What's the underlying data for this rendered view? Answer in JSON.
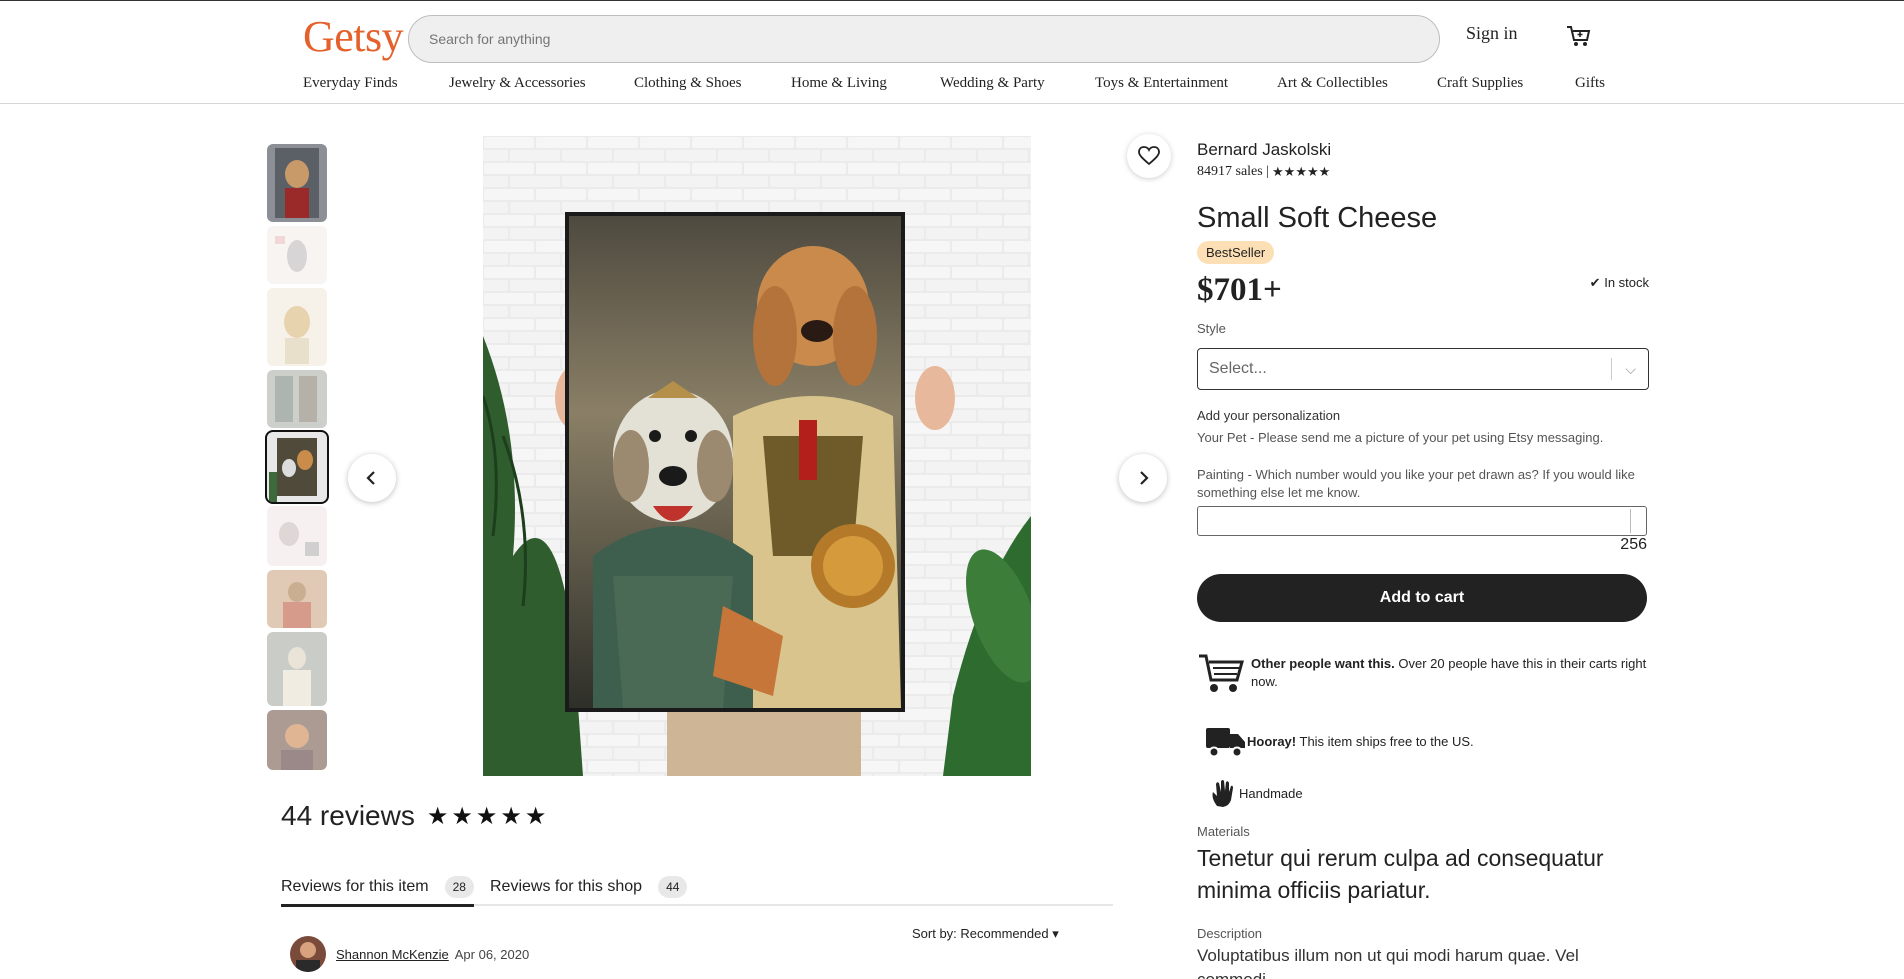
{
  "header": {
    "logo": "Getsy",
    "search_placeholder": "Search for anything",
    "sign_in": "Sign in"
  },
  "nav": {
    "items": [
      "Everyday Finds",
      "Jewelry & Accessories",
      "Clothing & Shoes",
      "Home & Living",
      "Wedding & Party",
      "Toys & Entertainment",
      "Art & Collectibles",
      "Craft Supplies",
      "Gifts"
    ]
  },
  "product": {
    "shop_name": "Bernard Jaskolski",
    "sales": "84917 sales |",
    "rating_stars": "★★★★★",
    "title": "Small Soft Cheese",
    "badge": "BestSeller",
    "price": "$701+",
    "stock": "In stock",
    "style_label": "Style",
    "style_placeholder": "Select...",
    "personalization_title": "Add your personalization",
    "personalization_desc": "Your Pet - Please send me a picture of your pet using Etsy messaging.",
    "painting_prompt": "Painting - Which number would you like your pet drawn as? If you would like something else let me know.",
    "char_count": "256",
    "add_to_cart": "Add to cart",
    "demand_bold": "Other people want this.",
    "demand_text": " Over 20 people have this in their carts right now.",
    "shipping_bold": "Hooray!",
    "shipping_text": " This item ships free to the US.",
    "handmade": "Handmade",
    "materials_label": "Materials",
    "materials": "Tenetur qui rerum culpa ad consequatur minima officiis pariatur.",
    "description_label": "Description",
    "description": "Voluptatibus illum non ut qui modi harum quae. Vel commodi"
  },
  "reviews": {
    "count_text": "44 reviews",
    "stars": "★★★★★",
    "tab_item": "Reviews for this item",
    "tab_item_count": "28",
    "tab_shop": "Reviews for this shop",
    "tab_shop_count": "44",
    "sort": "Sort by: Recommended",
    "first_reviewer": "Shannon McKenzie",
    "first_date": "Apr 06, 2020"
  },
  "colors": {
    "brand": "#e4612b",
    "badge_bg": "#fddfb5",
    "button_bg": "#222222"
  },
  "gallery": {
    "active_index": 4,
    "image_count": 9
  }
}
